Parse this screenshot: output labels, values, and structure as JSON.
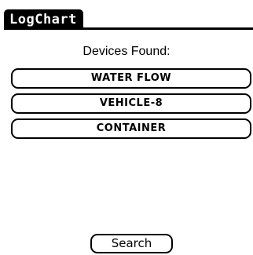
{
  "app": {
    "title": "LogChart"
  },
  "main": {
    "heading": "Devices Found:",
    "devices": [
      {
        "label": "WATER FLOW"
      },
      {
        "label": "VEHICLE-8"
      },
      {
        "label": "CONTAINER"
      }
    ],
    "search_label": "Search"
  },
  "colors": {
    "foreground": "#000000",
    "background": "#ffffff"
  }
}
